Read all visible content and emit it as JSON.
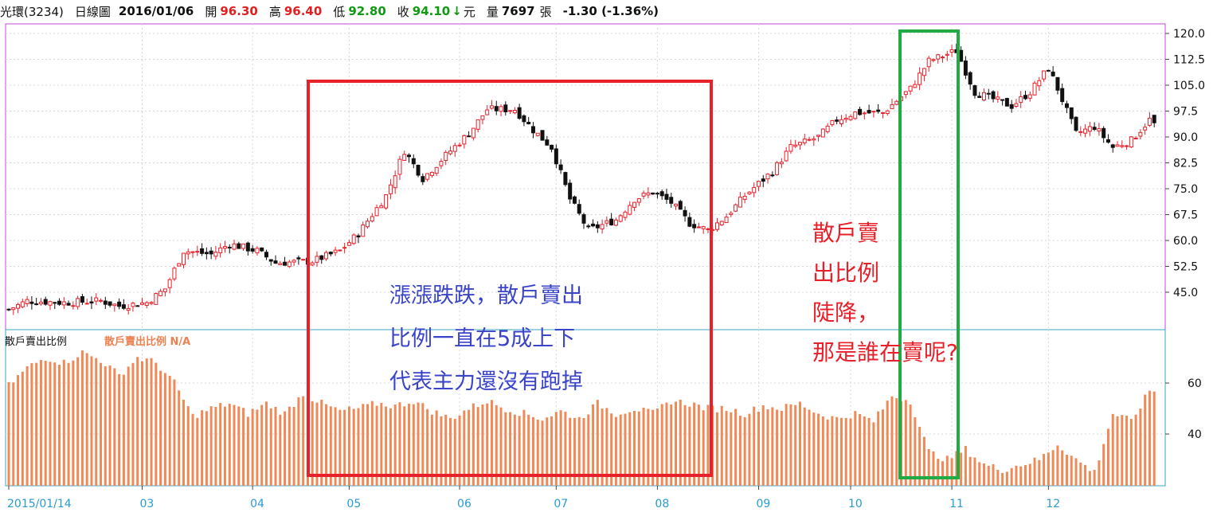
{
  "header": {
    "stock": "光環(3234)",
    "period": "日線圖",
    "date": "2016/01/06",
    "open_label": "開",
    "open": "96.30",
    "high_label": "高",
    "high": "96.40",
    "low_label": "低",
    "low": "92.80",
    "close_label": "收",
    "close": "94.10",
    "arrow": "↓",
    "unit": "元",
    "volume_label": "量",
    "volume": "7697",
    "volume_unit": "張",
    "change": "-1.30 (-1.36%)"
  },
  "sub_panel": {
    "title": "散戶賣出比例",
    "indicator": "散戶賣出比例 N/A"
  },
  "annotations": {
    "red_box_text": [
      "漲漲跌跌，散戶賣出",
      "比例一直在5成上下",
      "代表主力還沒有跑掉"
    ],
    "right_text": [
      "散戶賣",
      "出比例",
      "陡降，",
      "那是誰在賣呢?"
    ]
  },
  "colors": {
    "up": "#e8202a",
    "down": "#111111",
    "bar": "#ef8a58",
    "blue_text": "#3a44c8",
    "red_text": "#e8202a",
    "red_box": "#e8202a",
    "green_box": "#22aa44",
    "axis_label": "#2a9bd0"
  },
  "chart_data": [
    {
      "type": "candlestick",
      "title": "",
      "y_ticks": [
        "120.0",
        "112.5",
        "105.0",
        "97.5",
        "90.0",
        "82.5",
        "75.0",
        "67.5",
        "60.0",
        "52.5",
        "45.0"
      ],
      "ylim": [
        38,
        121
      ],
      "x_ticks": [
        "2015/01/14",
        "03",
        "04",
        "05",
        "06",
        "07",
        "08",
        "09",
        "10",
        "11",
        "12"
      ],
      "close_path": [
        [
          0,
          40.0
        ],
        [
          4,
          42.5
        ],
        [
          12,
          42.0
        ],
        [
          20,
          42.5
        ],
        [
          24,
          41.0
        ],
        [
          30,
          42.0
        ],
        [
          34,
          46.0
        ],
        [
          38,
          57.0
        ],
        [
          44,
          56.0
        ],
        [
          48,
          59.0
        ],
        [
          54,
          57.0
        ],
        [
          58,
          53.5
        ],
        [
          66,
          54.0
        ],
        [
          72,
          57.0
        ],
        [
          76,
          62.0
        ],
        [
          82,
          73.0
        ],
        [
          86,
          86.0
        ],
        [
          90,
          78.0
        ],
        [
          96,
          86.0
        ],
        [
          100,
          91.0
        ],
        [
          104,
          98.0
        ],
        [
          110,
          98.0
        ],
        [
          114,
          92.0
        ],
        [
          118,
          87.0
        ],
        [
          122,
          72.0
        ],
        [
          126,
          63.0
        ],
        [
          132,
          66.0
        ],
        [
          136,
          72.0
        ],
        [
          140,
          74.0
        ],
        [
          144,
          71.0
        ],
        [
          148,
          65.0
        ],
        [
          152,
          63.0
        ],
        [
          156,
          67.0
        ],
        [
          160,
          73.0
        ],
        [
          166,
          80.0
        ],
        [
          170,
          87.0
        ],
        [
          176,
          90.0
        ],
        [
          180,
          95.0
        ],
        [
          184,
          97.0
        ],
        [
          190,
          97.0
        ],
        [
          196,
          104.0
        ],
        [
          200,
          112.0
        ],
        [
          206,
          115.0
        ],
        [
          210,
          103.0
        ],
        [
          214,
          101.0
        ],
        [
          218,
          99.0
        ],
        [
          222,
          103.0
        ],
        [
          226,
          110.0
        ],
        [
          228,
          104.0
        ],
        [
          232,
          91.0
        ],
        [
          236,
          93.0
        ],
        [
          240,
          87.0
        ],
        [
          244,
          89.0
        ],
        [
          248,
          95.0
        ]
      ],
      "last": {
        "open": 96.3,
        "high": 96.4,
        "low": 92.8,
        "close": 94.1
      }
    },
    {
      "type": "bar",
      "title": "散戶賣出比例",
      "y_ticks": [
        "60",
        "40"
      ],
      "ylim": [
        20,
        80
      ],
      "ratio_path": [
        [
          0,
          59
        ],
        [
          4,
          66
        ],
        [
          8,
          70
        ],
        [
          12,
          68
        ],
        [
          16,
          72
        ],
        [
          20,
          69
        ],
        [
          24,
          63
        ],
        [
          28,
          70
        ],
        [
          32,
          68
        ],
        [
          36,
          60
        ],
        [
          40,
          47
        ],
        [
          44,
          50
        ],
        [
          48,
          52
        ],
        [
          52,
          48
        ],
        [
          56,
          52
        ],
        [
          60,
          48
        ],
        [
          64,
          56
        ],
        [
          68,
          52
        ],
        [
          72,
          49
        ],
        [
          76,
          50
        ],
        [
          80,
          52
        ],
        [
          84,
          51
        ],
        [
          88,
          53
        ],
        [
          92,
          49
        ],
        [
          96,
          46
        ],
        [
          100,
          50
        ],
        [
          104,
          53
        ],
        [
          108,
          50
        ],
        [
          112,
          48
        ],
        [
          116,
          46
        ],
        [
          120,
          49
        ],
        [
          124,
          46
        ],
        [
          128,
          52
        ],
        [
          132,
          48
        ],
        [
          136,
          50
        ],
        [
          140,
          48
        ],
        [
          144,
          53
        ],
        [
          148,
          52
        ],
        [
          152,
          50
        ],
        [
          156,
          50
        ],
        [
          160,
          48
        ],
        [
          164,
          51
        ],
        [
          168,
          50
        ],
        [
          172,
          52
        ],
        [
          176,
          48
        ],
        [
          180,
          46
        ],
        [
          184,
          48
        ],
        [
          188,
          45
        ],
        [
          192,
          55
        ],
        [
          196,
          53
        ],
        [
          200,
          33
        ],
        [
          204,
          30
        ],
        [
          208,
          34
        ],
        [
          212,
          28
        ],
        [
          216,
          26
        ],
        [
          220,
          28
        ],
        [
          224,
          30
        ],
        [
          228,
          36
        ],
        [
          232,
          30
        ],
        [
          236,
          25
        ],
        [
          240,
          48
        ],
        [
          244,
          45
        ],
        [
          248,
          57
        ]
      ]
    }
  ]
}
